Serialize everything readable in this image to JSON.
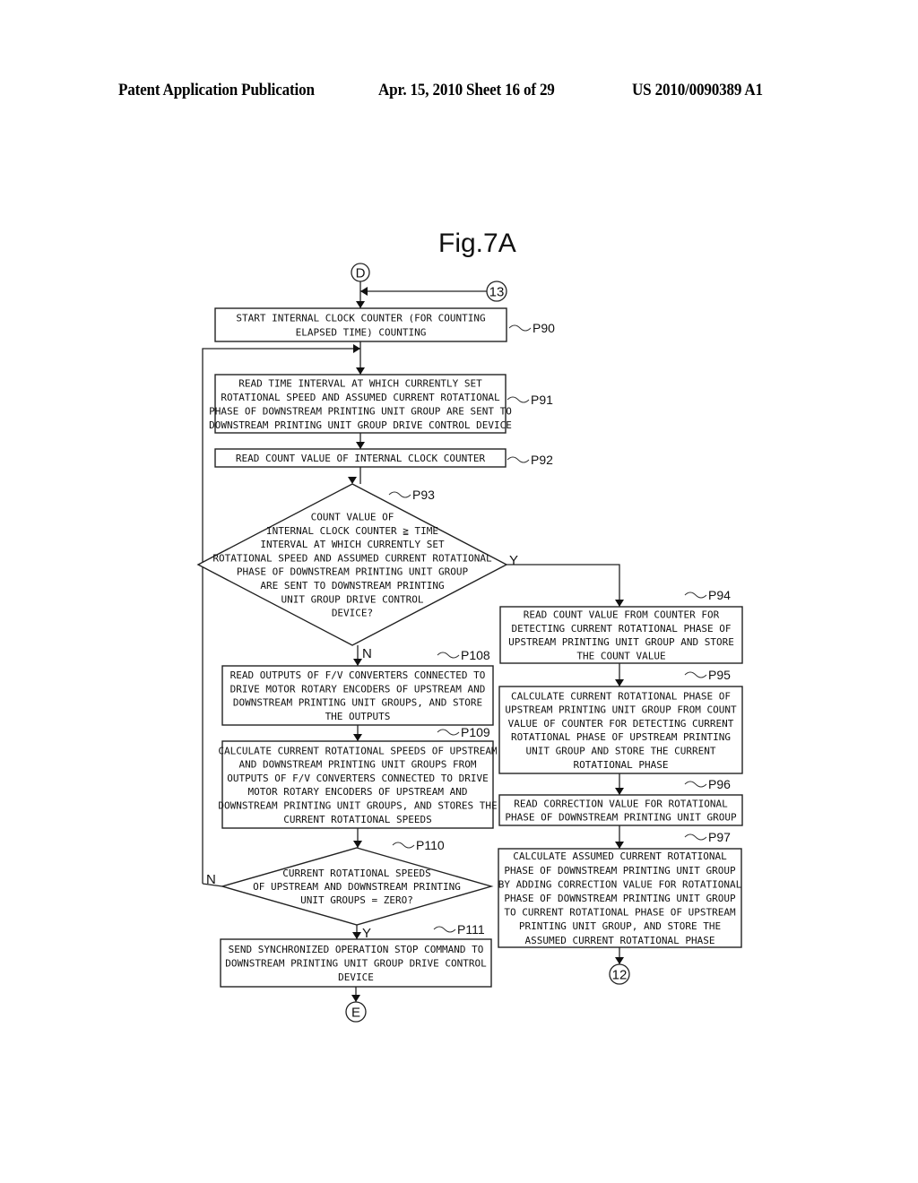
{
  "header": {
    "publication": "Patent Application Publication",
    "date_sheet": "Apr. 15, 2010  Sheet 16 of 29",
    "number": "US 2010/0090389 A1"
  },
  "figure": {
    "title": "Fig.7A",
    "connectors": {
      "D": "D",
      "c13": "13",
      "c12": "12",
      "E": "E"
    },
    "branch_labels": {
      "p93_yes": "Y",
      "p93_no": "N",
      "p110_yes": "Y",
      "p110_no": "N"
    },
    "steps": [
      {
        "id": "P90",
        "type": "process",
        "lines": [
          "START INTERNAL CLOCK COUNTER (FOR COUNTING",
          "ELAPSED TIME) COUNTING"
        ]
      },
      {
        "id": "P91",
        "type": "process",
        "lines": [
          "READ TIME INTERVAL AT WHICH CURRENTLY SET",
          "ROTATIONAL SPEED AND ASSUMED CURRENT ROTATIONAL",
          "PHASE OF DOWNSTREAM PRINTING UNIT GROUP ARE SENT TO",
          "DOWNSTREAM PRINTING UNIT GROUP DRIVE CONTROL DEVICE"
        ]
      },
      {
        "id": "P92",
        "type": "process",
        "lines": [
          "READ COUNT VALUE OF INTERNAL CLOCK COUNTER"
        ]
      },
      {
        "id": "P93",
        "type": "decision",
        "lines": [
          "COUNT VALUE OF",
          "INTERNAL CLOCK COUNTER ≧ TIME",
          "INTERVAL AT WHICH CURRENTLY SET",
          "ROTATIONAL SPEED AND ASSUMED CURRENT ROTATIONAL",
          "PHASE OF DOWNSTREAM PRINTING UNIT GROUP",
          "ARE SENT TO DOWNSTREAM PRINTING",
          "UNIT GROUP DRIVE CONTROL",
          "DEVICE?"
        ]
      },
      {
        "id": "P94",
        "type": "process",
        "lines": [
          "READ COUNT VALUE FROM COUNTER FOR",
          "DETECTING CURRENT ROTATIONAL PHASE OF",
          "UPSTREAM PRINTING UNIT GROUP AND STORE",
          "THE COUNT VALUE"
        ]
      },
      {
        "id": "P95",
        "type": "process",
        "lines": [
          "CALCULATE CURRENT ROTATIONAL PHASE OF",
          "UPSTREAM PRINTING UNIT GROUP FROM COUNT",
          "VALUE OF COUNTER FOR DETECTING CURRENT",
          "ROTATIONAL PHASE OF UPSTREAM PRINTING",
          "UNIT GROUP AND STORE THE CURRENT",
          "ROTATIONAL PHASE"
        ]
      },
      {
        "id": "P96",
        "type": "process",
        "lines": [
          "READ CORRECTION VALUE FOR ROTATIONAL",
          "PHASE OF DOWNSTREAM PRINTING UNIT GROUP"
        ]
      },
      {
        "id": "P97",
        "type": "process",
        "lines": [
          "CALCULATE ASSUMED CURRENT ROTATIONAL",
          "PHASE OF DOWNSTREAM PRINTING UNIT GROUP",
          "BY ADDING CORRECTION VALUE FOR ROTATIONAL",
          "PHASE OF DOWNSTREAM PRINTING UNIT GROUP",
          "TO CURRENT ROTATIONAL PHASE OF UPSTREAM",
          "PRINTING UNIT GROUP, AND STORE THE",
          "ASSUMED CURRENT ROTATIONAL PHASE"
        ]
      },
      {
        "id": "P108",
        "type": "process",
        "lines": [
          "READ OUTPUTS OF F/V CONVERTERS CONNECTED TO",
          "DRIVE MOTOR ROTARY ENCODERS OF UPSTREAM AND",
          "DOWNSTREAM PRINTING UNIT GROUPS, AND STORE",
          "THE OUTPUTS"
        ]
      },
      {
        "id": "P109",
        "type": "process",
        "lines": [
          "CALCULATE CURRENT ROTATIONAL SPEEDS OF UPSTREAM",
          "AND DOWNSTREAM PRINTING UNIT GROUPS FROM",
          "OUTPUTS OF F/V CONVERTERS CONNECTED TO DRIVE",
          "MOTOR ROTARY ENCODERS OF UPSTREAM AND",
          "DOWNSTREAM PRINTING UNIT GROUPS, AND STORES THE",
          "CURRENT ROTATIONAL SPEEDS"
        ]
      },
      {
        "id": "P110",
        "type": "decision",
        "lines": [
          "CURRENT ROTATIONAL SPEEDS",
          "OF UPSTREAM AND DOWNSTREAM PRINTING",
          "UNIT GROUPS = ZERO?"
        ]
      },
      {
        "id": "P111",
        "type": "process",
        "lines": [
          "SEND SYNCHRONIZED OPERATION STOP COMMAND TO",
          "DOWNSTREAM PRINTING UNIT GROUP DRIVE CONTROL",
          "DEVICE"
        ]
      }
    ]
  }
}
